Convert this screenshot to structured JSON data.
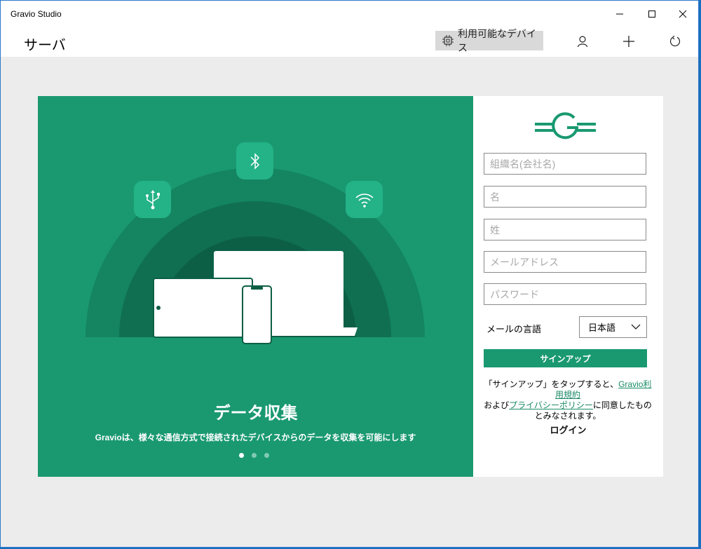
{
  "window": {
    "title": "Gravio Studio",
    "controls": {
      "minimize_icon": "minimize-icon",
      "maximize_icon": "maximize-icon",
      "close_icon": "close-icon"
    }
  },
  "appbar": {
    "page_title": "サーバ",
    "devices_button": {
      "label": "利用可能なデバイス",
      "icon": "chip-icon"
    },
    "icons": [
      "user-icon",
      "plus-icon",
      "refresh-icon"
    ]
  },
  "carousel": {
    "title": "データ収集",
    "description": "Gravioは、様々な通信方式で接続されたデバイスからのデータを収集を可能にします",
    "slide_count": 3,
    "active_index": 0,
    "icons": [
      "usb-icon",
      "bluetooth-icon",
      "wifi-icon"
    ]
  },
  "form": {
    "fields": {
      "org_placeholder": "組織名(会社名)",
      "first_name_placeholder": "名",
      "last_name_placeholder": "姓",
      "email_placeholder": "メールアドレス",
      "password_placeholder": "パスワード"
    },
    "language_label": "メールの言語",
    "language_value": "日本語",
    "signup_label": "サインアップ",
    "terms": {
      "prefix": "「サインアップ」をタップすると、",
      "terms_link": "Gravio利用規約",
      "middle": "および",
      "privacy_link": "プライバシーポリシー",
      "suffix": "に同意したものとみなされます。"
    },
    "login_label": "ログイン"
  },
  "colors": {
    "brand_green": "#1a9970",
    "panel_background": "#ececec"
  }
}
